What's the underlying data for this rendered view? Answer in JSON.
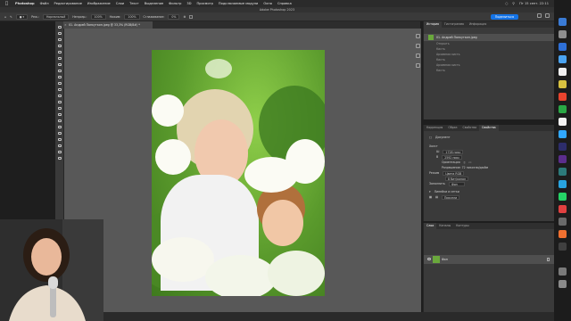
{
  "menubar": {
    "app_name": "Photoshop",
    "items": [
      "Файл",
      "Редактирование",
      "Изображение",
      "Слои",
      "Текст",
      "Выделение",
      "Фильтр",
      "3D",
      "Просмотр",
      "Подключаемые модули",
      "Окно",
      "Справка"
    ],
    "datetime": "Пт 15 сент. 22:11"
  },
  "window_title": "Adobe Photoshop 2023",
  "optionsbar": {
    "mode_label": "Реж.:",
    "mode_value": "Нормальный",
    "opacity_label": "Непрозр.:",
    "opacity_value": "100%",
    "flow_label": "Нажим:",
    "flow_value": "100%",
    "smooth_label": "Сглаживание:",
    "smooth_value": "0%",
    "share_label": "Поделиться"
  },
  "document": {
    "tab_label": "01. Андрей Панкуткин.jpeg @ 33,3% (RGB/8#) *"
  },
  "history_panel": {
    "tabs": [
      "История",
      "Гистограмма",
      "Инфорация"
    ],
    "snapshot": "01. Андрей Панкуткин.jpeg",
    "steps": [
      "Открыть",
      "Кисть",
      "Архивная кисть",
      "Кисть",
      "Архивная кисть",
      "Кисть"
    ]
  },
  "properties_panel": {
    "tabs": [
      "Коррекция",
      "Образ",
      "Свойства",
      "Свойства"
    ],
    "doc_label": "Документ",
    "canvas_label": "Холст",
    "width_value": "1728 пикс",
    "height_value": "2592 пикс",
    "orientation_label": "Ориентация",
    "resolution_label": "Разрешение: 72 пиксели/дюйм",
    "mode_label": "Режим",
    "mode_value": "Цвета RGB",
    "depth_value": "8 бит/канал",
    "fill_label": "Заполнить",
    "fill_value": "Фон",
    "rulers_label": "Линейки и сетки",
    "units_value": "Пиксели"
  },
  "layers_panel": {
    "tabs": [
      "Слои",
      "Каналы",
      "Контуры"
    ],
    "layer_name": "Фон"
  },
  "colors": {
    "accent": "#1473e6",
    "foreground": "#2a8a2a",
    "background": "#d62020"
  }
}
